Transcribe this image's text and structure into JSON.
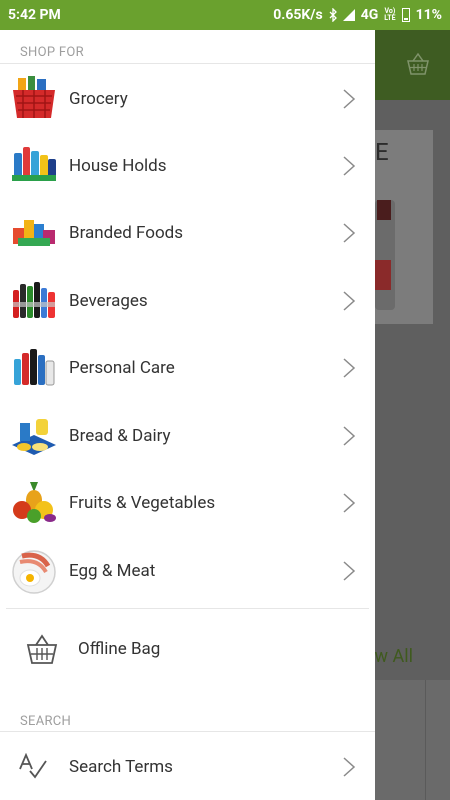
{
  "status_bar": {
    "time": "5:42 PM",
    "net_speed": "0.65K/s",
    "network": "4G",
    "volte_top": "Vo)",
    "volte_bottom": "LTE",
    "battery": "11%"
  },
  "drawer": {
    "shop_for_label": "SHOP FOR",
    "categories": [
      {
        "label": "Grocery",
        "icon": "grocery-basket-icon"
      },
      {
        "label": "House Holds",
        "icon": "household-products-icon"
      },
      {
        "label": "Branded Foods",
        "icon": "branded-foods-icon"
      },
      {
        "label": "Beverages",
        "icon": "beverage-bottles-icon"
      },
      {
        "label": "Personal Care",
        "icon": "personal-care-icon"
      },
      {
        "label": "Bread & Dairy",
        "icon": "bread-dairy-icon"
      },
      {
        "label": "Fruits & Vegetables",
        "icon": "fruits-vegetables-icon"
      },
      {
        "label": "Egg & Meat",
        "icon": "egg-meat-icon"
      }
    ],
    "offline_bag_label": "Offline Bag",
    "search_label": "SEARCH",
    "search_terms_label": "Search Terms"
  },
  "background": {
    "view_all_label": "ew All",
    "partial_letter": "E"
  },
  "colors": {
    "status_bar": "#6aa12e",
    "text": "#333333",
    "section_label": "#9e9e9e"
  }
}
